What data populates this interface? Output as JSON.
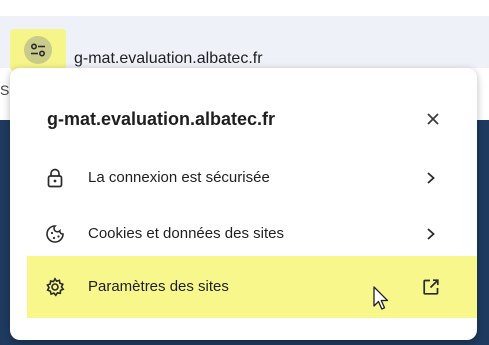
{
  "address_bar": {
    "url": "g-mat.evaluation.albatec.fr",
    "site_info_icon": "tune-icon",
    "left_edge_char": "S"
  },
  "popup": {
    "title": "g-mat.evaluation.albatec.fr",
    "close_icon": "close-icon",
    "items": [
      {
        "label": "La connexion est sécurisée",
        "icon": "lock-icon",
        "right_icon": "chevron-right-icon"
      },
      {
        "label": "Cookies et données des sites",
        "icon": "cookie-icon",
        "right_icon": "chevron-right-icon"
      },
      {
        "label": "Paramètres des sites",
        "icon": "settings-icon",
        "right_icon": "open-external-icon"
      }
    ]
  },
  "colors": {
    "highlight": "#f7f78c",
    "address_bar_bg": "#eef1f8",
    "page_bg_dark": "#1e3a5f"
  }
}
